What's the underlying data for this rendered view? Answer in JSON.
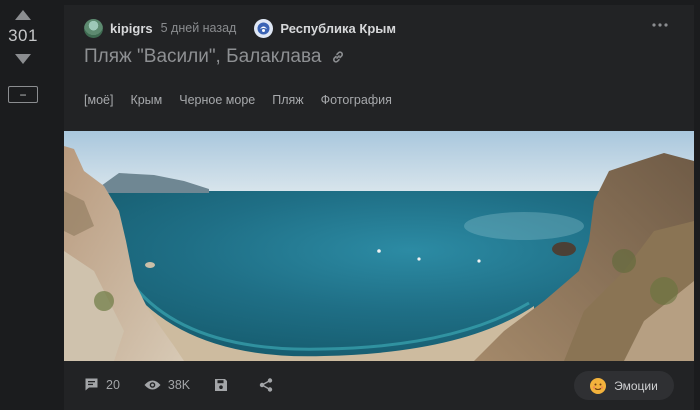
{
  "vote": {
    "count": "301",
    "collapse_label": "−"
  },
  "post": {
    "author": "kipigrs",
    "time": "5 дней назад",
    "community": "Республика Крым",
    "title": "Пляж \"Васили\", Балаклава",
    "tags": [
      "[моё]",
      "Крым",
      "Черное море",
      "Пляж",
      "Фотография"
    ]
  },
  "footer": {
    "comments": "20",
    "views": "38K",
    "emotions_label": "Эмоции"
  },
  "icons": {
    "vote_up": "triangle-up-icon",
    "vote_down": "triangle-down-icon",
    "more": "dots-horizontal-icon",
    "link": "link-icon",
    "comments": "comment-icon",
    "views": "eye-icon",
    "save": "floppy-icon",
    "share": "share-icon"
  },
  "colors": {
    "background": "#1b1c1e",
    "card": "#222325",
    "sea": "#1f6f86"
  }
}
